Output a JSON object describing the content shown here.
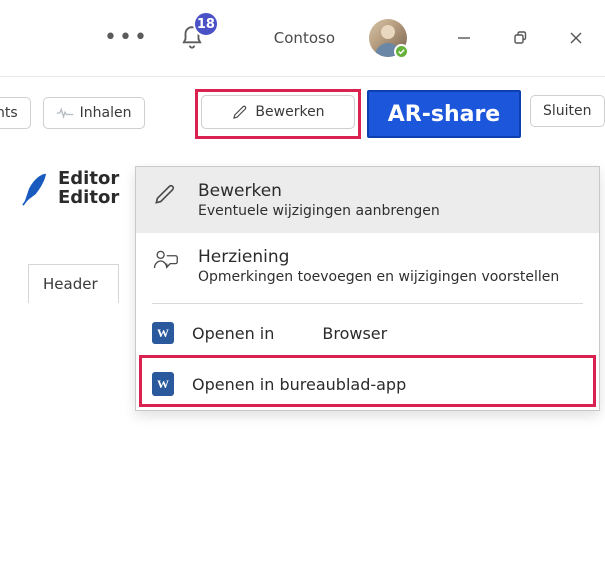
{
  "titlebar": {
    "notifications_count": "18",
    "org_name": "Contoso"
  },
  "toolbar": {
    "nts_fragment": "nts",
    "catchup_label": "Inhalen",
    "edit_label": "Bewerken",
    "share_label": "AR-share",
    "close_label": "Sluiten"
  },
  "panel": {
    "editor_line1": "Editor",
    "editor_line2": "Editor",
    "header_label": "Header"
  },
  "menu": {
    "edit": {
      "title": "Bewerken",
      "sub": "Eventuele wijzigingen aanbrengen"
    },
    "review": {
      "title": "Herziening",
      "sub": "Opmerkingen toevoegen en wijzigingen voorstellen"
    },
    "open_prefix": "Openen in",
    "open_browser": "Browser",
    "open_desktop": "Openen in bureaublad-app"
  }
}
